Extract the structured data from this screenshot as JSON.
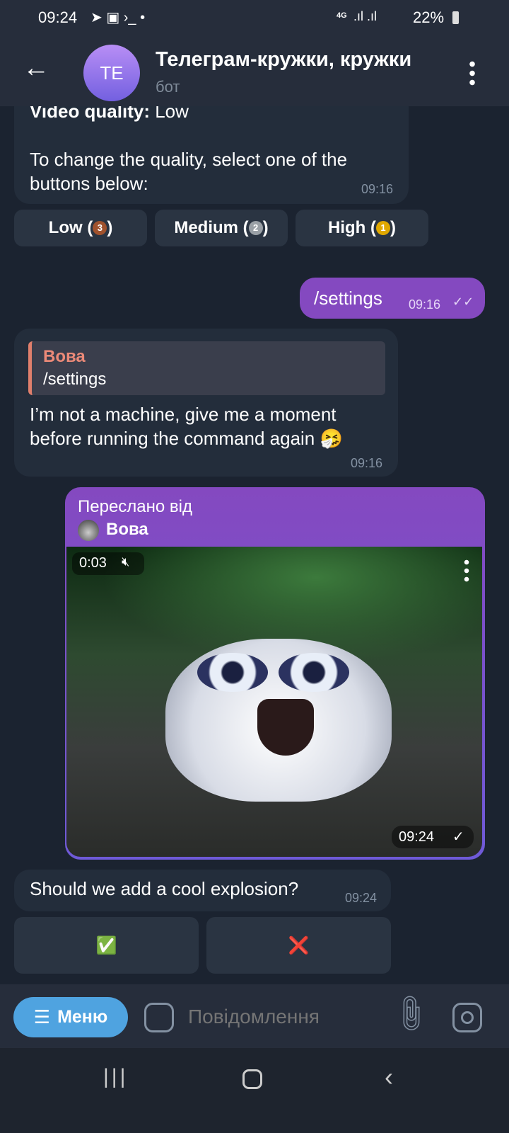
{
  "status": {
    "time": "09:24",
    "network": "4G",
    "battery": "22%"
  },
  "header": {
    "avatar": "TE",
    "title": "Телеграм-кружки, кружки",
    "subtitle": "бот"
  },
  "messages": {
    "quality": {
      "line1_label": "Video quality:",
      "line1_value": " Low",
      "line2": "To change the quality, select one of the buttons below:",
      "time": "09:16"
    },
    "quality_buttons": [
      {
        "label": "Low (",
        "medal": "3",
        "end": ")"
      },
      {
        "label": "Medium (",
        "medal": "2",
        "end": ")"
      },
      {
        "label": "High (",
        "medal": "1",
        "end": ")"
      }
    ],
    "settings_out": {
      "text": "/settings",
      "time": "09:16"
    },
    "reply": {
      "quote_author": "Вова",
      "quote_text": "/settings",
      "text": "I’m not a machine, give me a moment before running the command again 🤧",
      "time": "09:16"
    },
    "forward": {
      "label": "Переслано від",
      "author": "Вова",
      "duration": "0:03",
      "time": "09:24"
    },
    "question": {
      "text": "Should we add a cool explosion?",
      "time": "09:24"
    },
    "answer_buttons": [
      {
        "label": "✅"
      },
      {
        "label": "❌"
      }
    ]
  },
  "input": {
    "menu_label": "Меню",
    "placeholder": "Повідомлення"
  },
  "colors": {
    "accent": "#8449c0",
    "menu": "#4fa3e0"
  }
}
